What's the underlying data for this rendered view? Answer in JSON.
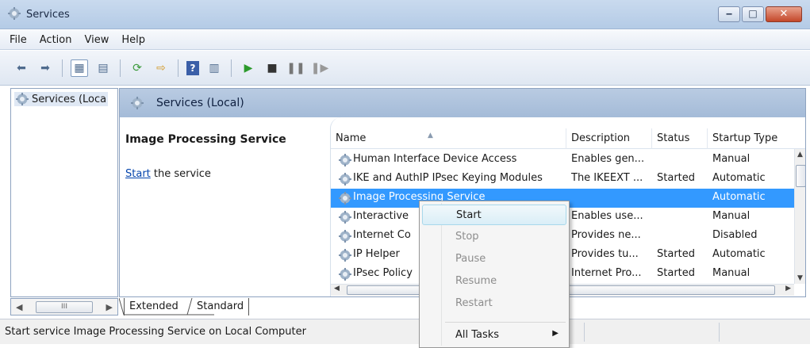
{
  "window": {
    "title": "Services",
    "min_glyph": "‒",
    "max_glyph": "□",
    "close_glyph": "✕"
  },
  "menu": [
    "File",
    "Action",
    "View",
    "Help"
  ],
  "tree": {
    "item": "Services (Loca",
    "scroll_glyph": "III"
  },
  "header": {
    "title": "Services (Local)"
  },
  "description": {
    "service_name": "Image Processing Service",
    "start_link": "Start",
    "start_rest": " the service"
  },
  "list": {
    "columns": [
      "Name",
      "Description",
      "Status",
      "Startup Type"
    ],
    "rows": [
      {
        "name": "Human Interface Device Access",
        "description": "Enables gen...",
        "status": "",
        "startup": "Manual"
      },
      {
        "name": "IKE and AuthIP IPsec Keying Modules",
        "description": "The IKEEXT ...",
        "status": "Started",
        "startup": "Automatic"
      },
      {
        "name": "Image Processing Service",
        "description": "",
        "status": "",
        "startup": "Automatic",
        "selected": true
      },
      {
        "name": "Interactive",
        "description": "Enables use...",
        "status": "",
        "startup": "Manual"
      },
      {
        "name": "Internet Co",
        "description": "Provides ne...",
        "status": "",
        "startup": "Disabled"
      },
      {
        "name": "IP Helper",
        "description": "Provides tu...",
        "status": "Started",
        "startup": "Automatic"
      },
      {
        "name": "IPsec Policy",
        "description": "Internet Pro...",
        "status": "Started",
        "startup": "Manual"
      }
    ]
  },
  "tabs": [
    "Extended",
    "Standard"
  ],
  "status_bar": "Start service Image Processing Service on Local Computer",
  "context_menu": {
    "items": [
      {
        "label": "Start",
        "enabled": true
      },
      {
        "label": "Stop",
        "enabled": false
      },
      {
        "label": "Pause",
        "enabled": false
      },
      {
        "label": "Resume",
        "enabled": false
      },
      {
        "label": "Restart",
        "enabled": false
      },
      {
        "label": "All Tasks",
        "enabled": true,
        "submenu": true
      }
    ]
  },
  "colors": {
    "selection": "#3399ff",
    "header": "#a4bbd8",
    "link": "#0645ad"
  },
  "icons": [
    "services-gear-icon",
    "back-arrow-icon",
    "forward-arrow-icon",
    "console-tree-icon",
    "refresh-icon",
    "export-icon",
    "help-icon",
    "play-icon",
    "stop-icon",
    "pause-icon",
    "resume-icon"
  ]
}
